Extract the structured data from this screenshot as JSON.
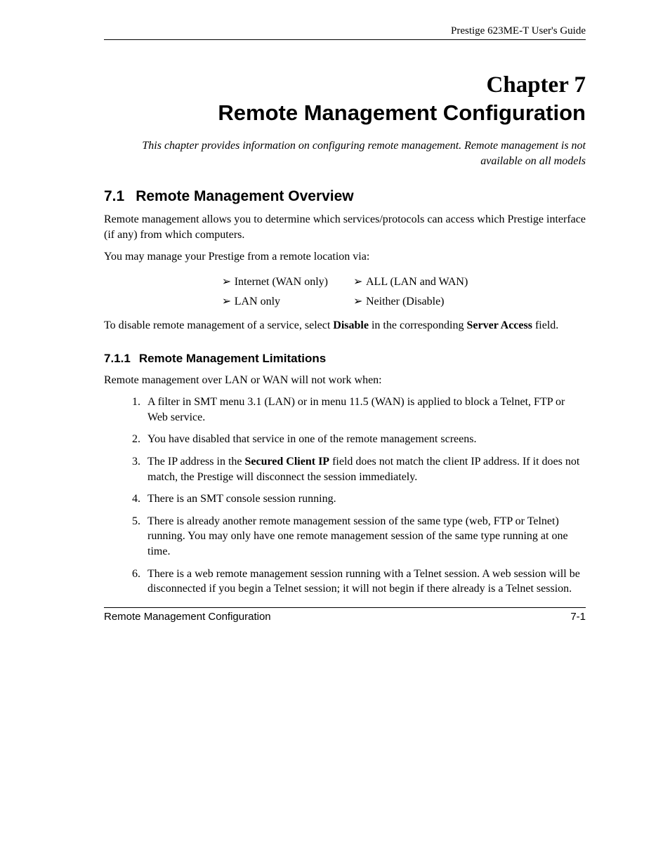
{
  "header": "Prestige 623ME-T User's Guide",
  "chapter_num": "Chapter 7",
  "chapter_title": "Remote Management Configuration",
  "intro": "This chapter provides information on configuring remote management. Remote management is not available on all models",
  "section": {
    "num": "7.1",
    "title": "Remote Management Overview"
  },
  "p1": "Remote management allows you to determine which services/protocols can access which Prestige interface (if any) from which computers.",
  "p2": "You may manage your Prestige from a remote location via:",
  "options": {
    "r1c1": "Internet (WAN only)",
    "r1c2": "ALL (LAN and WAN)",
    "r2c1": "LAN only",
    "r2c2": "Neither (Disable)"
  },
  "p3_a": "To disable remote management of a service, select ",
  "p3_b": "Disable",
  "p3_c": " in the corresponding ",
  "p3_d": "Server Access",
  "p3_e": " field.",
  "subsection": {
    "num": "7.1.1",
    "title": "Remote Management Limitations"
  },
  "p4": "Remote management over LAN or WAN will not work when:",
  "list": {
    "i1": "A filter in SMT menu 3.1 (LAN) or in menu 11.5 (WAN) is applied to block a Telnet, FTP or Web service.",
    "i2": "You have disabled that service in one of the remote management screens.",
    "i3_a": "The IP address in the ",
    "i3_b": "Secured Client IP",
    "i3_c": " field does not match the client IP address. If it does not match, the Prestige will disconnect the session immediately.",
    "i4": "There is an SMT console session running.",
    "i5": "There is already another remote management session of the same type (web, FTP or Telnet) running. You may only have one remote management session of the same type running at one time.",
    "i6": "There is a web remote management session running with a Telnet session. A web session will be disconnected if you begin a Telnet session; it will not begin if there already is a Telnet session."
  },
  "footer_left": "Remote Management Configuration",
  "footer_right": "7-1",
  "glyph": {
    "arrow": "➢"
  }
}
